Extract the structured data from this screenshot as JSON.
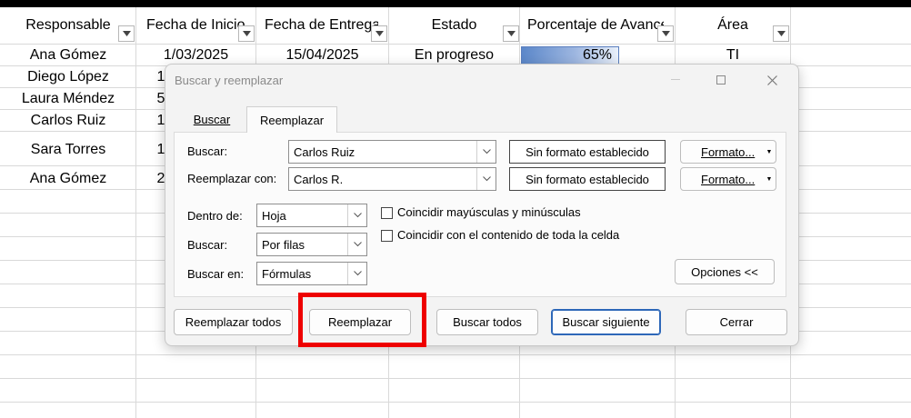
{
  "sheet": {
    "headers": [
      "Responsable",
      "Fecha de Inicio",
      "Fecha de Entrega",
      "Estado",
      "Porcentaje de Avance",
      "Área"
    ],
    "row1": {
      "responsable": "Ana Gómez",
      "inicio": "1/03/2025",
      "entrega": "15/04/2025",
      "estado": "En progreso",
      "avance": "65%",
      "avance_value": 0.65,
      "area": "TI"
    },
    "names": [
      "Diego López",
      "Laura Méndez",
      "Carlos Ruiz",
      "Sara Torres",
      "Ana Gómez"
    ],
    "partial_dates": [
      "1",
      "5",
      "1",
      "1",
      "2"
    ]
  },
  "dialog": {
    "title": "Buscar y reemplazar",
    "tabs": {
      "buscar": "Buscar",
      "reemplazar": "Reemplazar"
    },
    "find": {
      "label": "Buscar:",
      "value": "Carlos Ruiz",
      "format_status": "Sin formato establecido",
      "format_button": "Formato..."
    },
    "replace": {
      "label": "Reemplazar con:",
      "value": "Carlos R.",
      "format_status": "Sin formato establecido",
      "format_button": "Formato..."
    },
    "within": {
      "label": "Dentro de:",
      "value": "Hoja"
    },
    "search": {
      "label": "Buscar:",
      "value": "Por filas"
    },
    "look_in": {
      "label": "Buscar en:",
      "value": "Fórmulas"
    },
    "match_case": {
      "label": "Coincidir mayúsculas y minúsculas",
      "checked": false
    },
    "match_entire": {
      "label": "Coincidir con el contenido de toda la celda",
      "checked": false
    },
    "options_button": "Opciones <<",
    "buttons": {
      "replace_all": "Reemplazar todos",
      "replace": "Reemplazar",
      "find_all": "Buscar todos",
      "find_next": "Buscar siguiente",
      "close": "Cerrar"
    }
  },
  "colors": {
    "highlight": "#ee0000",
    "primary_border": "#2d67b8",
    "bar": "#5b87c9"
  }
}
